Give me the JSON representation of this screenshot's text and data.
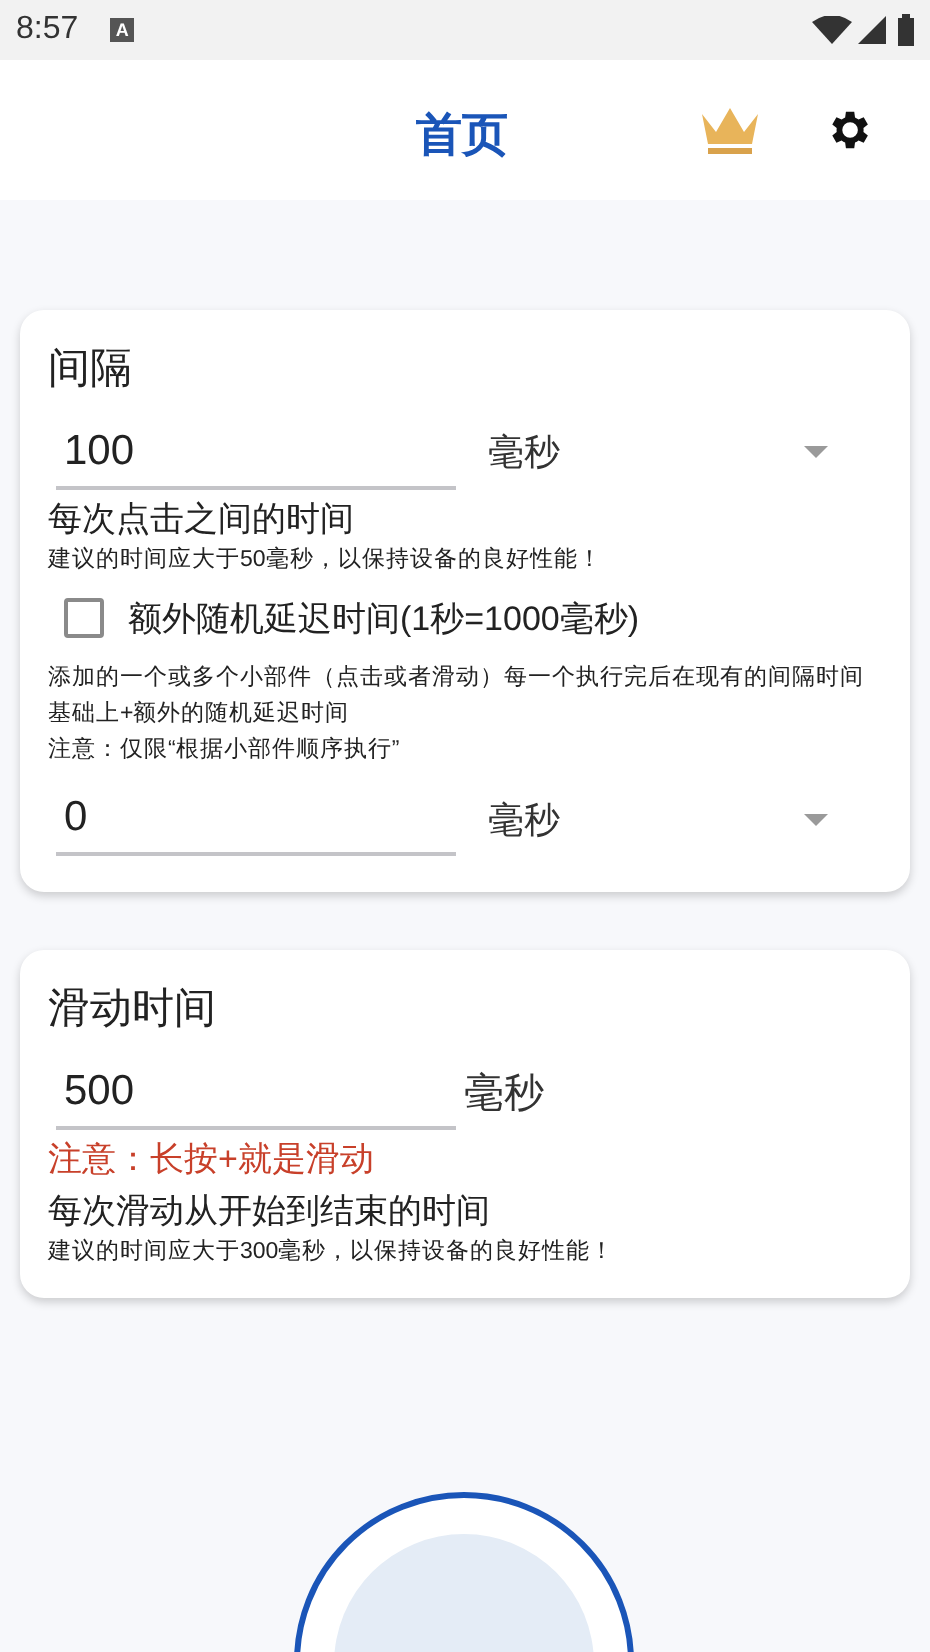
{
  "status_bar": {
    "time": "8:57",
    "notification_glyph": "A"
  },
  "header": {
    "title": "首页"
  },
  "cards": [
    {
      "title": "间隔",
      "items": [
        {
          "kind": "field",
          "value": "100",
          "unit": "毫秒",
          "dropdown": true
        },
        {
          "kind": "label",
          "text": "每次点击之间的时间"
        },
        {
          "kind": "hint",
          "text": "建议的时间应大于50毫秒，以保持设备的良好性能！"
        },
        {
          "kind": "checkbox",
          "label": "额外随机延迟时间(1秒=1000毫秒)",
          "checked": false
        },
        {
          "kind": "hint",
          "text": "添加的一个或多个小部件（点击或者滑动）每一个执行完后在现有的间隔时间基础上+额外的随机延迟时间"
        },
        {
          "kind": "hint",
          "text": "注意：仅限“根据小部件顺序执行”"
        },
        {
          "kind": "field",
          "value": "0",
          "unit": "毫秒",
          "dropdown": true
        }
      ]
    },
    {
      "title": "滑动时间",
      "items": [
        {
          "kind": "field",
          "value": "500",
          "unit": "毫秒",
          "dropdown": false
        },
        {
          "kind": "warning",
          "text": "注意：长按+就是滑动"
        },
        {
          "kind": "label",
          "text": "每次滑动从开始到结束的时间"
        },
        {
          "kind": "hint",
          "text": "建议的时间应大于300毫秒，以保持设备的良好性能！"
        }
      ]
    }
  ]
}
